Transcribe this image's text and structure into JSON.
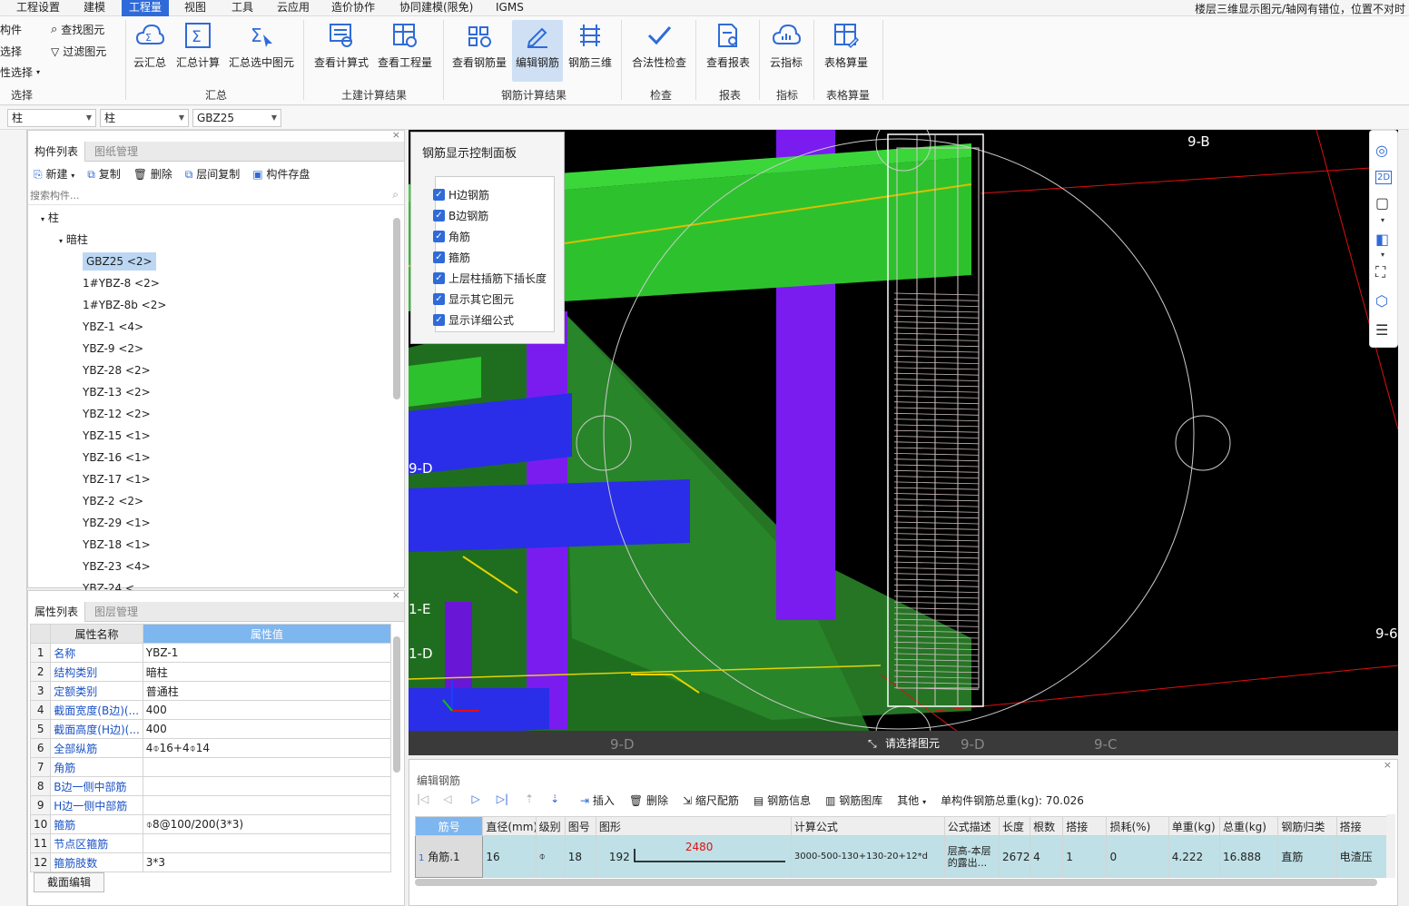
{
  "menubar": {
    "items": [
      "工程设置",
      "建模",
      "工程量",
      "视图",
      "工具",
      "云应用",
      "造价协作",
      "协同建模(限免)",
      "IGMS"
    ],
    "active": "工程量",
    "notice": "楼层三维显示图元/轴网有错位，位置不对时"
  },
  "ribbon": {
    "select_group": {
      "items": [
        "构件",
        "选择",
        "性选择"
      ],
      "find": "查找图元",
      "filter": "过滤图元",
      "label": "选择"
    },
    "summary_group": {
      "buttons": [
        "云汇总",
        "汇总计算",
        "汇总选中图元"
      ],
      "label": "汇总"
    },
    "civil_group": {
      "buttons": [
        "查看计算式",
        "查看工程量"
      ],
      "label": "土建计算结果"
    },
    "rebar_group": {
      "buttons": [
        "查看钢筋量",
        "编辑钢筋",
        "钢筋三维"
      ],
      "label": "钢筋计算结果"
    },
    "check_group": {
      "buttons": [
        "合法性检查"
      ],
      "label": "检查"
    },
    "report_group": {
      "buttons": [
        "查看报表"
      ],
      "label": "报表"
    },
    "index_group": {
      "buttons": [
        "云指标"
      ],
      "label": "指标"
    },
    "table_group": {
      "buttons": [
        "表格算量"
      ],
      "label": "表格算量"
    }
  },
  "toolbar2": {
    "dropdowns": [
      "柱",
      "柱",
      "GBZ25"
    ]
  },
  "component_panel": {
    "tabs": [
      "构件列表",
      "图纸管理"
    ],
    "actions": [
      "新建",
      "复制",
      "删除",
      "层间复制",
      "构件存盘"
    ],
    "search_placeholder": "搜索构件...",
    "tree_root": "柱",
    "tree_group": "暗柱",
    "items": [
      "GBZ25 <2>",
      "1#YBZ-8 <2>",
      "1#YBZ-8b <2>",
      "YBZ-1 <4>",
      "YBZ-9 <2>",
      "YBZ-28 <2>",
      "YBZ-13 <2>",
      "YBZ-12 <2>",
      "YBZ-15 <1>",
      "YBZ-16 <1>",
      "YBZ-17 <1>",
      "YBZ-2 <2>",
      "YBZ-29 <1>",
      "YBZ-18 <1>",
      "YBZ-23 <4>",
      "YBZ-24 <..."
    ]
  },
  "property_panel": {
    "tabs": [
      "属性列表",
      "图层管理"
    ],
    "headers": [
      "属性名称",
      "属性值"
    ],
    "rows": [
      {
        "no": "1",
        "name": "名称",
        "value": "YBZ-1"
      },
      {
        "no": "2",
        "name": "结构类别",
        "value": "暗柱"
      },
      {
        "no": "3",
        "name": "定额类别",
        "value": "普通柱"
      },
      {
        "no": "4",
        "name": "截面宽度(B边)(...",
        "value": "400"
      },
      {
        "no": "5",
        "name": "截面高度(H边)(...",
        "value": "400"
      },
      {
        "no": "6",
        "name": "全部纵筋",
        "value": "4⌽16+4⌽14"
      },
      {
        "no": "7",
        "name": "角筋",
        "value": ""
      },
      {
        "no": "8",
        "name": "B边一侧中部筋",
        "value": ""
      },
      {
        "no": "9",
        "name": "H边一侧中部筋",
        "value": ""
      },
      {
        "no": "10",
        "name": "箍筋",
        "value": "⌽8@100/200(3*3)"
      },
      {
        "no": "11",
        "name": "节点区箍筋",
        "value": ""
      },
      {
        "no": "12",
        "name": "箍筋肢数",
        "value": "3*3"
      }
    ],
    "section_edit": "截面编辑"
  },
  "viewport": {
    "axis_labels": [
      "9-B",
      "9-D",
      "1-E",
      "1-D",
      "9-6",
      "9-D",
      "9-D",
      "9-C"
    ],
    "prompt": "请选择图元"
  },
  "rebar_panel": {
    "title": "钢筋显示控制面板",
    "options": [
      "H边钢筋",
      "B边钢筋",
      "角筋",
      "箍筋",
      "上层柱插筋下插长度",
      "显示其它图元",
      "显示详细公式"
    ]
  },
  "editor": {
    "title": "编辑钢筋",
    "actions": [
      "插入",
      "删除",
      "缩尺配筋",
      "钢筋信息",
      "钢筋图库",
      "其他"
    ],
    "total_weight": "单构件钢筋总重(kg): 70.026",
    "headers": [
      "筋号",
      "直径(mm)",
      "级别",
      "图号",
      "图形",
      "计算公式",
      "公式描述",
      "长度",
      "根数",
      "搭接",
      "损耗(%)",
      "单重(kg)",
      "总重(kg)",
      "钢筋归类",
      "搭接"
    ],
    "row": {
      "idx": "1",
      "name": "角筋.1",
      "diameter": "16",
      "grade": "⌽",
      "figure": "18",
      "shape_left": "192",
      "shape_len": "2480",
      "formula": "3000-500-130+130-20+12*d",
      "desc": "层高-本层的露出...",
      "length": "2672",
      "count": "4",
      "lap": "1",
      "loss": "0",
      "unit_w": "4.222",
      "total_w": "16.888",
      "category": "直筋",
      "lap2": "电渣压"
    }
  },
  "colors": {
    "accent": "#2f6bd8",
    "green": "#2ec12e",
    "blue": "#2a2ee8",
    "purple": "#7a1cf0"
  }
}
